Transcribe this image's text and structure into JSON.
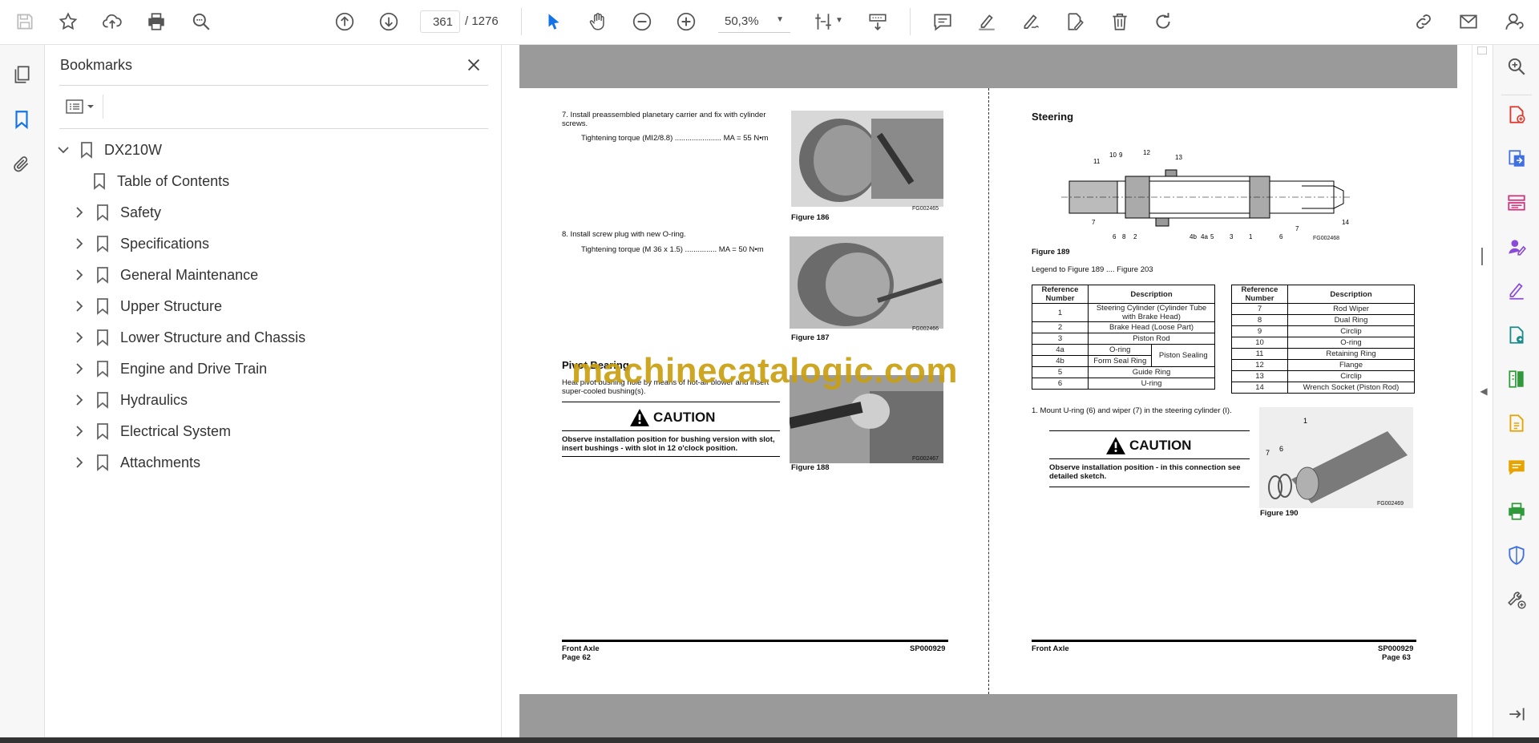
{
  "toolbar": {
    "current_page": "361",
    "total_pages": "/ 1276",
    "zoom": "50,3%"
  },
  "bookmarks": {
    "title": "Bookmarks",
    "root": "DX210W",
    "items": [
      {
        "label": "Table of Contents",
        "expandable": false
      },
      {
        "label": "Safety",
        "expandable": true
      },
      {
        "label": "Specifications",
        "expandable": true
      },
      {
        "label": "General Maintenance",
        "expandable": true
      },
      {
        "label": "Upper Structure",
        "expandable": true
      },
      {
        "label": "Lower Structure and Chassis",
        "expandable": true
      },
      {
        "label": "Engine and Drive Train",
        "expandable": true
      },
      {
        "label": "Hydraulics",
        "expandable": true
      },
      {
        "label": "Electrical System",
        "expandable": true
      },
      {
        "label": "Attachments",
        "expandable": true
      }
    ]
  },
  "watermark": "machinecatalogic.com",
  "left_page": {
    "step7": "7.    Install preassembled planetary carrier and fix with cylinder screws.",
    "step7_torque": "Tightening torque (MI2/8.8) ...................... MA = 55 N•m",
    "fig186": "Figure 186",
    "fg465": "FG002465",
    "step8": "8.    Install screw plug with new O-ring.",
    "step8_torque": "Tightening torque (M 36 x 1.5) ............... MA = 50 N•m",
    "fig187": "Figure 187",
    "fg466": "FG002466",
    "heading": "Pivot Bearing",
    "pivot_text": "Heat pivot bushing hole by means of hot-air blower and insert super-cooled bushing(s).",
    "caution": "CAUTION",
    "caution_text": "Observe installation position for bushing version with slot, insert bushings - with slot in 12 o'clock position.",
    "fig188": "Figure 188",
    "fg467": "FG002467",
    "footer_left": "Front Axle",
    "footer_page": "Page 62",
    "footer_right": "SP000929"
  },
  "right_page": {
    "heading": "Steering",
    "fig189": "Figure 189",
    "fg468": "FG002468",
    "legend": "Legend to Figure 189 .... Figure 203",
    "col_ref": "Reference Number",
    "col_desc": "Description",
    "table_left": [
      {
        "ref": "1",
        "desc": "Steering Cylinder (Cylinder Tube with Brake Head)"
      },
      {
        "ref": "2",
        "desc": "Brake Head (Loose Part)"
      },
      {
        "ref": "3",
        "desc": "Piston Rod"
      },
      {
        "ref": "4a",
        "desc": "O-ring"
      },
      {
        "ref": "4b",
        "desc": "Form Seal Ring"
      },
      {
        "ref": "5",
        "desc": "Guide Ring"
      },
      {
        "ref": "6",
        "desc": "U-ring"
      }
    ],
    "piston_sealing": "Piston Sealing",
    "table_right": [
      {
        "ref": "7",
        "desc": "Rod Wiper"
      },
      {
        "ref": "8",
        "desc": "Dual Ring"
      },
      {
        "ref": "9",
        "desc": "Circlip"
      },
      {
        "ref": "10",
        "desc": "O-ring"
      },
      {
        "ref": "11",
        "desc": "Retaining Ring"
      },
      {
        "ref": "12",
        "desc": "Flange"
      },
      {
        "ref": "13",
        "desc": "Circlip"
      },
      {
        "ref": "14",
        "desc": "Wrench Socket (Piston Rod)"
      }
    ],
    "step1": "1.    Mount U-ring (6) and wiper (7) in the steering cylinder (I).",
    "caution": "CAUTION",
    "caution_text": "Observe installation position - in this connection see detailed sketch.",
    "fig190": "Figure 190",
    "fg469": "FG002469",
    "footer_left": "Front Axle",
    "footer_page": "Page 63",
    "footer_right": "SP000929"
  },
  "colors": {
    "accent": "#1473e6",
    "watermark": "#c9a012",
    "grey_bg": "#9a9a9a"
  }
}
